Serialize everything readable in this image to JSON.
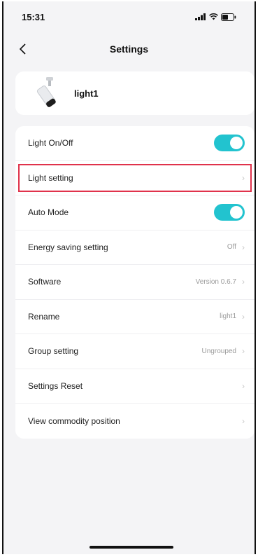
{
  "status": {
    "time": "15:31"
  },
  "nav": {
    "title": "Settings"
  },
  "device": {
    "name": "light1"
  },
  "rows": [
    {
      "label": "Light On/Off",
      "kind": "toggle",
      "on": true
    },
    {
      "label": "Light setting",
      "kind": "chevron",
      "value": "",
      "highlighted": true
    },
    {
      "label": "Auto Mode",
      "kind": "toggle",
      "on": true
    },
    {
      "label": "Energy saving setting",
      "kind": "chevron",
      "value": "Off"
    },
    {
      "label": "Software",
      "kind": "chevron",
      "value": "Version 0.6.7"
    },
    {
      "label": "Rename",
      "kind": "chevron",
      "value": "light1"
    },
    {
      "label": "Group setting",
      "kind": "chevron",
      "value": "Ungrouped"
    },
    {
      "label": "Settings Reset",
      "kind": "chevron",
      "value": ""
    },
    {
      "label": "View commodity position",
      "kind": "chevron",
      "value": ""
    }
  ],
  "colors": {
    "accent": "#22c3cf",
    "highlight": "#e0324b",
    "background": "#f4f4f6"
  }
}
